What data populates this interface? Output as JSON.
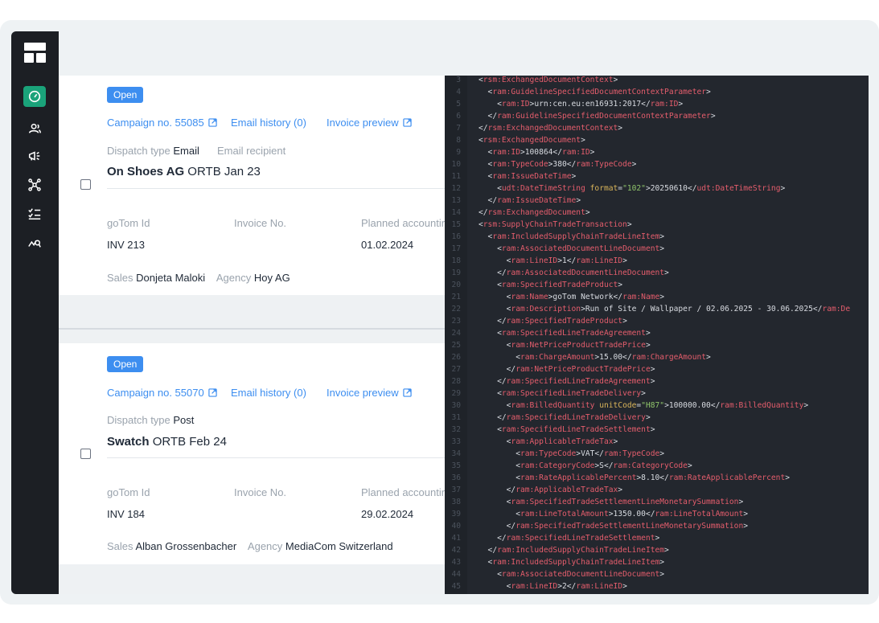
{
  "cards": [
    {
      "status": "Open",
      "campaign_link": "Campaign no. 55085",
      "email_history_link": "Email history (0)",
      "invoice_preview_link": "Invoice preview",
      "dispatch_label": "Dispatch type",
      "dispatch_value": "Email",
      "extra_label": "Email recipient",
      "company": "On Shoes AG",
      "subtitle": "ORTB Jan 23",
      "col1_header": "goTom Id",
      "col2_header": "Invoice No.",
      "col3_header": "Planned accountin",
      "col1_value": "INV 213",
      "col3_value": "01.02.2024",
      "sales_label": "Sales",
      "sales_value": "Donjeta Maloki",
      "agency_label": "Agency",
      "agency_value": "Hoy AG"
    },
    {
      "status": "Open",
      "campaign_link": "Campaign no. 55070",
      "email_history_link": "Email history (0)",
      "invoice_preview_link": "Invoice preview",
      "dispatch_label": "Dispatch type",
      "dispatch_value": "Post",
      "company": "Swatch",
      "subtitle": "ORTB Feb 24",
      "col1_header": "goTom Id",
      "col2_header": "Invoice No.",
      "col3_header": "Planned accountin",
      "col1_value": "INV 184",
      "col3_value": "29.02.2024",
      "sales_label": "Sales",
      "sales_value": "Alban Grossenbacher",
      "agency_label": "Agency",
      "agency_value": "MediaCom Switzerland"
    }
  ],
  "sidebar_icons": [
    "layout-logo-icon",
    "dashboard-gauge-icon",
    "users-icon",
    "campaign-megaphone-icon",
    "network-icon",
    "checklist-icon",
    "analytics-icon"
  ],
  "colors": {
    "accent": "#3d8ef0",
    "sidebar_active": "#1aa37a",
    "sidebar_bg": "#1c1f24",
    "code_bg": "#23272e"
  },
  "code_lines": [
    {
      "n": "3",
      "t": "<rsm:ExchangedDocumentContext>"
    },
    {
      "n": "4",
      "t": "  <ram:GuidelineSpecifiedDocumentContextParameter>"
    },
    {
      "n": "5",
      "t": "    <ram:ID>urn:cen.eu:en16931:2017</ram:ID>"
    },
    {
      "n": "6",
      "t": "  </ram:GuidelineSpecifiedDocumentContextParameter>"
    },
    {
      "n": "7",
      "t": "</rsm:ExchangedDocumentContext>"
    },
    {
      "n": "8",
      "t": "<rsm:ExchangedDocument>"
    },
    {
      "n": "9",
      "t": "  <ram:ID>100864</ram:ID>"
    },
    {
      "n": "10",
      "t": "  <ram:TypeCode>380</ram:TypeCode>"
    },
    {
      "n": "11",
      "t": "  <ram:IssueDateTime>"
    },
    {
      "n": "12",
      "t": "    <udt:DateTimeString format=\"102\">20250610</udt:DateTimeString>"
    },
    {
      "n": "13",
      "t": "  </ram:IssueDateTime>"
    },
    {
      "n": "14",
      "t": "</rsm:ExchangedDocument>"
    },
    {
      "n": "15",
      "t": "<rsm:SupplyChainTradeTransaction>"
    },
    {
      "n": "16",
      "t": "  <ram:IncludedSupplyChainTradeLineItem>"
    },
    {
      "n": "17",
      "t": "    <ram:AssociatedDocumentLineDocument>"
    },
    {
      "n": "18",
      "t": "      <ram:LineID>1</ram:LineID>"
    },
    {
      "n": "19",
      "t": "    </ram:AssociatedDocumentLineDocument>"
    },
    {
      "n": "20",
      "t": "    <ram:SpecifiedTradeProduct>"
    },
    {
      "n": "21",
      "t": "      <ram:Name>goTom Network</ram:Name>"
    },
    {
      "n": "22",
      "t": "      <ram:Description>Run of Site / Wallpaper / 02.06.2025 - 30.06.2025</ram:De"
    },
    {
      "n": "23",
      "t": "    </ram:SpecifiedTradeProduct>"
    },
    {
      "n": "24",
      "t": "    <ram:SpecifiedLineTradeAgreement>"
    },
    {
      "n": "25",
      "t": "      <ram:NetPriceProductTradePrice>"
    },
    {
      "n": "26",
      "t": "        <ram:ChargeAmount>15.00</ram:ChargeAmount>"
    },
    {
      "n": "27",
      "t": "      </ram:NetPriceProductTradePrice>"
    },
    {
      "n": "28",
      "t": "    </ram:SpecifiedLineTradeAgreement>"
    },
    {
      "n": "29",
      "t": "    <ram:SpecifiedLineTradeDelivery>"
    },
    {
      "n": "30",
      "t": "      <ram:BilledQuantity unitCode=\"H87\">100000.00</ram:BilledQuantity>"
    },
    {
      "n": "31",
      "t": "    </ram:SpecifiedLineTradeDelivery>"
    },
    {
      "n": "32",
      "t": "    <ram:SpecifiedLineTradeSettlement>"
    },
    {
      "n": "33",
      "t": "      <ram:ApplicableTradeTax>"
    },
    {
      "n": "34",
      "t": "        <ram:TypeCode>VAT</ram:TypeCode>"
    },
    {
      "n": "35",
      "t": "        <ram:CategoryCode>S</ram:CategoryCode>"
    },
    {
      "n": "36",
      "t": "        <ram:RateApplicablePercent>8.10</ram:RateApplicablePercent>"
    },
    {
      "n": "37",
      "t": "      </ram:ApplicableTradeTax>"
    },
    {
      "n": "38",
      "t": "      <ram:SpecifiedTradeSettlementLineMonetarySummation>"
    },
    {
      "n": "39",
      "t": "        <ram:LineTotalAmount>1350.00</ram:LineTotalAmount>"
    },
    {
      "n": "40",
      "t": "      </ram:SpecifiedTradeSettlementLineMonetarySummation>"
    },
    {
      "n": "41",
      "t": "    </ram:SpecifiedLineTradeSettlement>"
    },
    {
      "n": "42",
      "t": "  </ram:IncludedSupplyChainTradeLineItem>"
    },
    {
      "n": "43",
      "t": "  <ram:IncludedSupplyChainTradeLineItem>"
    },
    {
      "n": "44",
      "t": "    <ram:AssociatedDocumentLineDocument>"
    },
    {
      "n": "45",
      "t": "      <ram:LineID>2</ram:LineID>"
    }
  ]
}
